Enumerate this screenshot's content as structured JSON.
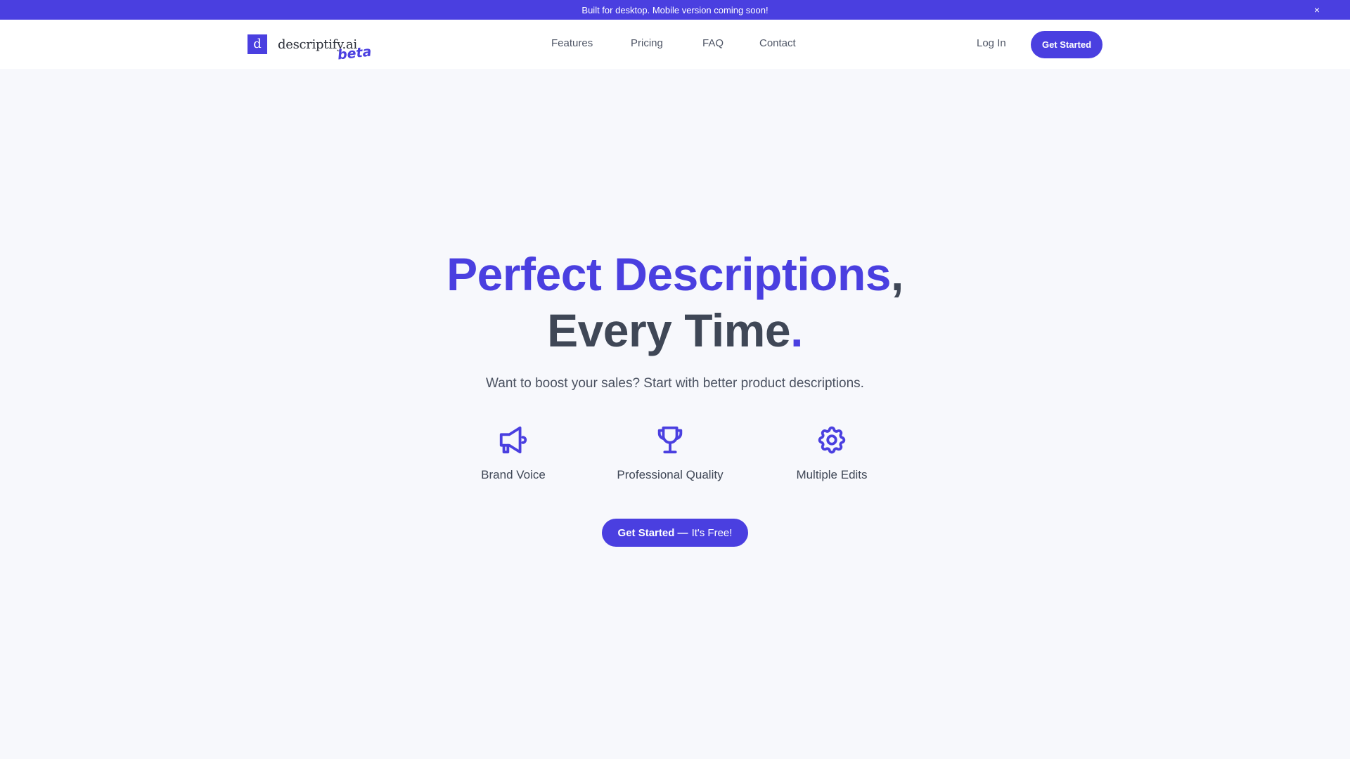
{
  "banner": {
    "message": "Built for desktop. Mobile version coming soon!",
    "close_icon": "×"
  },
  "nav": {
    "logo_letter": "d",
    "logo_text": "descriptify.ai",
    "logo_badge": "beta",
    "links": [
      {
        "label": "Features"
      },
      {
        "label": "Pricing"
      },
      {
        "label": "FAQ"
      },
      {
        "label": "Contact"
      }
    ],
    "login_label": "Log In",
    "get_started_label": "Get Started"
  },
  "hero": {
    "title_line1": "Perfect Descriptions",
    "title_line1_punct": ",",
    "title_line2": "Every Time",
    "title_line2_punct": ".",
    "subtitle": "Want to boost your sales? Start with better product descriptions.",
    "features": [
      {
        "icon": "megaphone-icon",
        "label": "Brand Voice"
      },
      {
        "icon": "trophy-icon",
        "label": "Professional Quality"
      },
      {
        "icon": "gear-icon",
        "label": "Multiple Edits"
      }
    ],
    "cta_strong": "Get Started —",
    "cta_light": "It's Free!"
  },
  "colors": {
    "brand": "#4a3fe0",
    "text_dark": "#3f4756",
    "background": "#f7f8fc"
  }
}
